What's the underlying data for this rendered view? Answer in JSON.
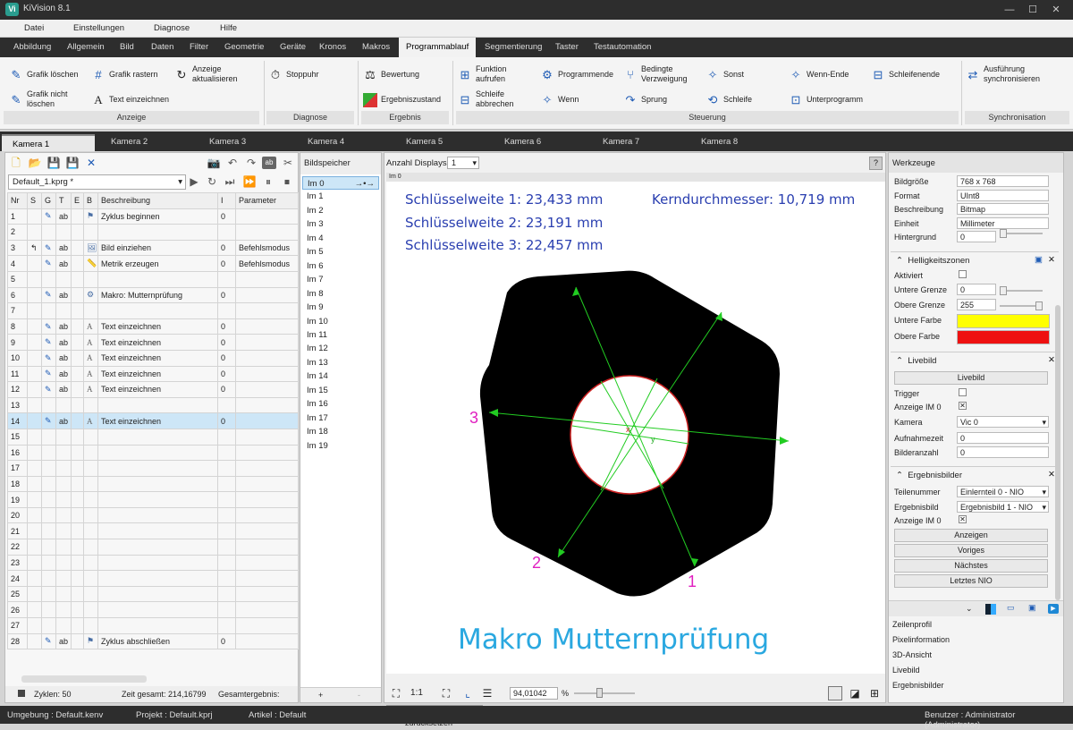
{
  "window": {
    "title": "KiVision 8.1",
    "logo": "Vi"
  },
  "menu": [
    "Datei",
    "Einstellungen",
    "Diagnose",
    "Hilfe"
  ],
  "ribbon_tabs": [
    "Abbildung",
    "Allgemein",
    "Bild",
    "Daten",
    "Filter",
    "Geometrie",
    "Geräte",
    "Kronos",
    "Makros",
    "Programmablauf",
    "Segmentierung",
    "Taster",
    "Testautomation"
  ],
  "ribbon": {
    "grafik_loeschen": "Grafik löschen",
    "grafik_rastern": "Grafik rastern",
    "anzeige_aktualisieren_1": "Anzeige",
    "anzeige_aktualisieren_2": "aktualisieren",
    "grafik_nicht_1": "Grafik nicht",
    "grafik_nicht_2": "löschen",
    "text_einzeichnen": "Text einzeichnen",
    "stoppuhr": "Stoppuhr",
    "bewertung": "Bewertung",
    "ergebniszustand": "Ergebniszustand",
    "funktion_1": "Funktion",
    "funktion_2": "aufrufen",
    "schleife_abbr_1": "Schleife",
    "schleife_abbr_2": "abbrechen",
    "programmende": "Programmende",
    "bedingte_1": "Bedingte",
    "bedingte_2": "Verzweigung",
    "sonst": "Sonst",
    "wenn_ende": "Wenn-Ende",
    "schleifenende": "Schleifenende",
    "wenn": "Wenn",
    "sprung": "Sprung",
    "schleife": "Schleife",
    "unterprogramm": "Unterprogramm",
    "ausfuehrung_1": "Ausführung",
    "ausfuehrung_2": "synchronisieren",
    "groups": {
      "anzeige": "Anzeige",
      "diagnose": "Diagnose",
      "ergebnis": "Ergebnis",
      "steuerung": "Steuerung",
      "synchronisation": "Synchronisation"
    }
  },
  "camera_tabs": [
    "Kamera 1",
    "Kamera 2",
    "Kamera 3",
    "Kamera 4",
    "Kamera 5",
    "Kamera 6",
    "Kamera 7",
    "Kamera 8"
  ],
  "program": {
    "file": "Default_1.kprg *",
    "columns": [
      "Nr",
      "S",
      "G",
      "T",
      "E",
      "B",
      "Beschreibung",
      "I",
      "Parameter"
    ],
    "rows": [
      {
        "nr": "1",
        "g": true,
        "t": "ab",
        "desc": "Zyklus beginnen",
        "i": "0",
        "param": "",
        "icon": "flag"
      },
      {
        "nr": "2",
        "g": false,
        "t": "",
        "desc": "",
        "i": "",
        "param": "",
        "icon": ""
      },
      {
        "nr": "3",
        "g": true,
        "t": "ab",
        "desc": "Bild einziehen",
        "i": "0",
        "param": "Befehlsmodus",
        "icon": "img",
        "s": true
      },
      {
        "nr": "4",
        "g": true,
        "t": "ab",
        "desc": "Metrik erzeugen",
        "i": "0",
        "param": "Befehlsmodus",
        "icon": "ruler"
      },
      {
        "nr": "5",
        "g": false,
        "t": "",
        "desc": "",
        "i": "",
        "param": "",
        "icon": ""
      },
      {
        "nr": "6",
        "g": true,
        "t": "ab",
        "desc": "Makro: Mutternprüfung",
        "i": "0",
        "param": "",
        "icon": "gear"
      },
      {
        "nr": "7",
        "g": false,
        "t": "",
        "desc": "",
        "i": "",
        "param": "",
        "icon": ""
      },
      {
        "nr": "8",
        "g": true,
        "t": "ab",
        "desc": "Text einzeichnen",
        "i": "0",
        "param": "",
        "icon": "A"
      },
      {
        "nr": "9",
        "g": true,
        "t": "ab",
        "desc": "Text einzeichnen",
        "i": "0",
        "param": "",
        "icon": "A"
      },
      {
        "nr": "10",
        "g": true,
        "t": "ab",
        "desc": "Text einzeichnen",
        "i": "0",
        "param": "",
        "icon": "A"
      },
      {
        "nr": "11",
        "g": true,
        "t": "ab",
        "desc": "Text einzeichnen",
        "i": "0",
        "param": "",
        "icon": "A"
      },
      {
        "nr": "12",
        "g": true,
        "t": "ab",
        "desc": "Text einzeichnen",
        "i": "0",
        "param": "",
        "icon": "A"
      },
      {
        "nr": "13",
        "g": false,
        "t": "",
        "desc": "",
        "i": "",
        "param": "",
        "icon": ""
      },
      {
        "nr": "14",
        "g": true,
        "t": "ab",
        "desc": "Text einzeichnen",
        "i": "0",
        "param": "",
        "icon": "A",
        "selected": true
      },
      {
        "nr": "15",
        "g": false,
        "t": "",
        "desc": "",
        "i": "",
        "param": "",
        "icon": ""
      },
      {
        "nr": "16",
        "g": false,
        "t": "",
        "desc": "",
        "i": "",
        "param": "",
        "icon": ""
      },
      {
        "nr": "17",
        "g": false,
        "t": "",
        "desc": "",
        "i": "",
        "param": "",
        "icon": ""
      },
      {
        "nr": "18",
        "g": false,
        "t": "",
        "desc": "",
        "i": "",
        "param": "",
        "icon": ""
      },
      {
        "nr": "19",
        "g": false,
        "t": "",
        "desc": "",
        "i": "",
        "param": "",
        "icon": ""
      },
      {
        "nr": "20",
        "g": false,
        "t": "",
        "desc": "",
        "i": "",
        "param": "",
        "icon": ""
      },
      {
        "nr": "21",
        "g": false,
        "t": "",
        "desc": "",
        "i": "",
        "param": "",
        "icon": ""
      },
      {
        "nr": "22",
        "g": false,
        "t": "",
        "desc": "",
        "i": "",
        "param": "",
        "icon": ""
      },
      {
        "nr": "23",
        "g": false,
        "t": "",
        "desc": "",
        "i": "",
        "param": "",
        "icon": ""
      },
      {
        "nr": "24",
        "g": false,
        "t": "",
        "desc": "",
        "i": "",
        "param": "",
        "icon": ""
      },
      {
        "nr": "25",
        "g": false,
        "t": "",
        "desc": "",
        "i": "",
        "param": "",
        "icon": ""
      },
      {
        "nr": "26",
        "g": false,
        "t": "",
        "desc": "",
        "i": "",
        "param": "",
        "icon": ""
      },
      {
        "nr": "27",
        "g": false,
        "t": "",
        "desc": "",
        "i": "",
        "param": "",
        "icon": ""
      },
      {
        "nr": "28",
        "g": true,
        "t": "ab",
        "desc": "Zyklus abschließen",
        "i": "0",
        "param": "",
        "icon": "flag"
      }
    ],
    "status_zyklen": "Zyklen: 50",
    "status_zeit": "Zeit gesamt: 214,16799",
    "status_gesamt": "Gesamtergebnis:"
  },
  "bildspeicher": {
    "title": "Bildspeicher",
    "items": [
      "Im 0",
      "Im 1",
      "Im 2",
      "Im 3",
      "Im 4",
      "Im 5",
      "Im 6",
      "Im 7",
      "Im 8",
      "Im 9",
      "Im 10",
      "Im 11",
      "Im 12",
      "Im 13",
      "Im 14",
      "Im 15",
      "Im 16",
      "Im 17",
      "Im 18",
      "Im 19"
    ],
    "add": "+",
    "remove": "-"
  },
  "display": {
    "anzahl_label": "Anzahl Displays",
    "anzahl_value": "1",
    "image_label": "Im 0",
    "text1": "Schlüsselweite 1: 23,433 mm",
    "text2": "Schlüsselweite 2: 23,191 mm",
    "text3": "Schlüsselweite 3: 22,457 mm",
    "text4": "Kerndurchmesser: 10,719 mm",
    "macro_title": "Makro Mutternprüfung",
    "label1": "1",
    "label2": "2",
    "label3": "3",
    "axis_x": "x",
    "axis_y": "y",
    "zoom_value": "94,01042",
    "zoom_unit": "%",
    "zoom_1to1": "1:1",
    "tooltip": "Ansicht zurücksetzen"
  },
  "werkzeuge": {
    "title": "Werkzeuge",
    "bild": [
      {
        "label": "Bildgröße",
        "value": "768 x 768"
      },
      {
        "label": "Format",
        "value": "UInt8"
      },
      {
        "label": "Beschreibung",
        "value": "Bitmap"
      },
      {
        "label": "Einheit",
        "value": "Millimeter"
      },
      {
        "label": "Hintergrund",
        "value": "0"
      }
    ],
    "helligkeit": {
      "title": "Helligkeitszonen",
      "aktiviert": "Aktiviert",
      "untere_grenze": "Untere Grenze",
      "untere_grenze_val": "0",
      "obere_grenze": "Obere Grenze",
      "obere_grenze_val": "255",
      "untere_farbe": "Untere Farbe",
      "untere_farbe_color": "#ffff00",
      "obere_farbe": "Obere Farbe",
      "obere_farbe_color": "#ee1111"
    },
    "livebild": {
      "title": "Livebild",
      "button": "Livebild",
      "trigger": "Trigger",
      "anzeige": "Anzeige IM 0",
      "kamera": "Kamera",
      "kamera_val": "Vic 0",
      "aufnahmezeit": "Aufnahmezeit",
      "aufnahmezeit_val": "0",
      "bilderanzahl": "Bilderanzahl",
      "bilderanzahl_val": "0"
    },
    "ergebnisbilder": {
      "title": "Ergebnisbilder",
      "teilenummer": "Teilenummer",
      "teilenummer_val": "Einlernteil 0 - NIO",
      "ergebnisbild": "Ergebnisbild",
      "ergebnisbild_val": "Ergebnisbild 1 - NIO",
      "anzeige": "Anzeige IM 0",
      "buttons": [
        "Anzeigen",
        "Voriges",
        "Nächstes",
        "Letztes NIO"
      ]
    },
    "list": [
      "Zeilenprofil",
      "Pixelinformation",
      "3D-Ansicht",
      "Livebild",
      "Ergebnisbilder"
    ]
  },
  "statusbar": {
    "umgebung": "Umgebung :  Default.kenv",
    "projekt": "Projekt :  Default.kprj",
    "artikel": "Artikel :  Default",
    "benutzer": "Benutzer :  Administrator (Administrator)"
  },
  "colors": {
    "accent_blue": "#2a3fb0",
    "label_magenta": "#e020c0",
    "macro_cyan": "#2aa8e0",
    "line_green": "#22cc22"
  }
}
